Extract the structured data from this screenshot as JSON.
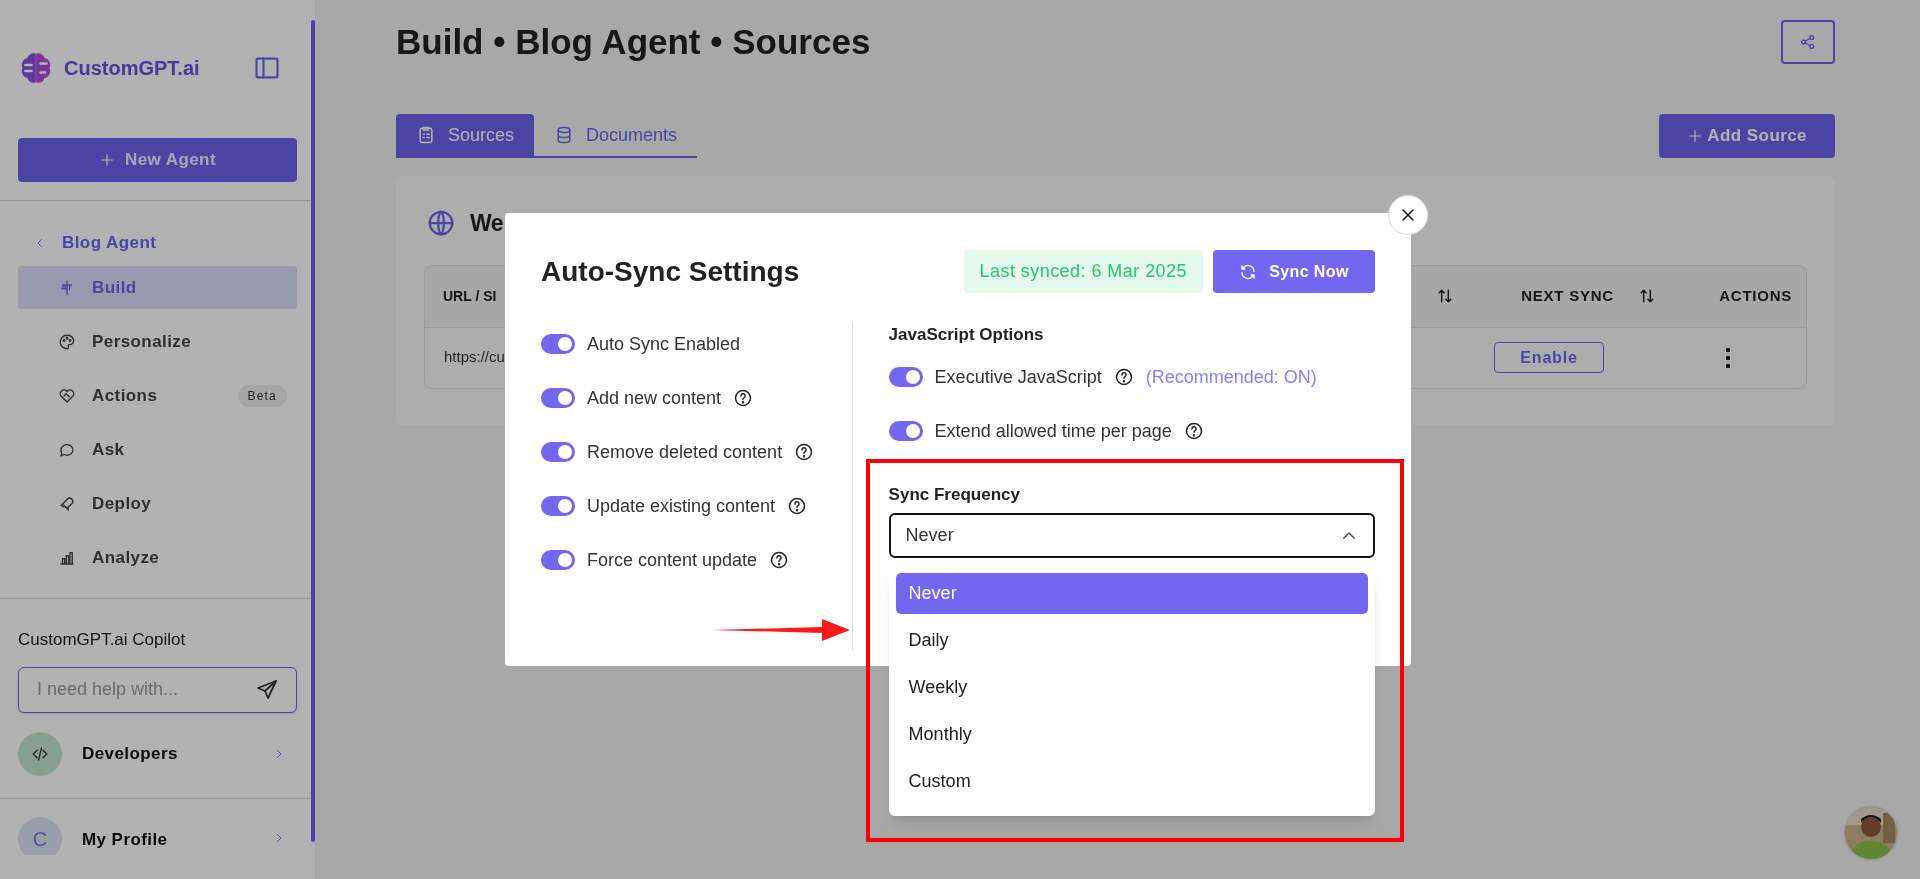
{
  "sidebar": {
    "brand": "CustomGPT.ai",
    "new_agent": "New Agent",
    "back_link": "Blog Agent",
    "items": [
      {
        "kind": "build",
        "label": "Build",
        "selected": true
      },
      {
        "kind": "personalize",
        "label": "Personalize",
        "selected": false
      },
      {
        "kind": "actions",
        "label": "Actions",
        "selected": false,
        "badge": "Beta"
      },
      {
        "kind": "ask",
        "label": "Ask",
        "selected": false
      },
      {
        "kind": "deploy",
        "label": "Deploy",
        "selected": false
      },
      {
        "kind": "analyze",
        "label": "Analyze",
        "selected": false
      }
    ],
    "copilot": {
      "title": "CustomGPT.ai Copilot",
      "placeholder": "I need help with..."
    },
    "developers": "Developers",
    "profile": {
      "initial": "C",
      "label": "My Profile"
    }
  },
  "page": {
    "title": "Build • Blog Agent • Sources",
    "tabs": [
      {
        "kind": "sources",
        "label": "Sources",
        "selected": true
      },
      {
        "kind": "documents",
        "label": "Documents",
        "selected": false
      }
    ],
    "add_source": "Add Source",
    "card": {
      "heading": "We",
      "table": {
        "columns": [
          "URL / SI",
          "NEXT SYNC",
          "ACTIONS"
        ],
        "rows": [
          {
            "url": "https://cu",
            "next_sync": "Enable"
          }
        ]
      }
    }
  },
  "modal": {
    "title": "Auto-Sync Settings",
    "last_synced": "Last synced: 6 Mar 2025",
    "sync_now": "Sync Now",
    "toggles": [
      {
        "label": "Auto Sync Enabled",
        "on": true,
        "help": false
      },
      {
        "label": "Add new content",
        "on": true,
        "help": true
      },
      {
        "label": "Remove deleted content",
        "on": true,
        "help": true
      },
      {
        "label": "Update existing content",
        "on": true,
        "help": true
      },
      {
        "label": "Force content update",
        "on": true,
        "help": true
      }
    ],
    "js_options": {
      "title": "JavaScript Options",
      "toggles": [
        {
          "label": "Executive JavaScript",
          "on": true,
          "help": true,
          "note": "(Recommended: ON)"
        },
        {
          "label": "Extend allowed time per page",
          "on": true,
          "help": true
        }
      ]
    },
    "sync_frequency": {
      "label": "Sync Frequency",
      "value": "Never",
      "expanded": true,
      "options": [
        {
          "label": "Never",
          "selected": true
        },
        {
          "label": "Daily",
          "selected": false
        },
        {
          "label": "Weekly",
          "selected": false
        },
        {
          "label": "Monthly",
          "selected": false
        },
        {
          "label": "Custom",
          "selected": false
        }
      ]
    }
  }
}
